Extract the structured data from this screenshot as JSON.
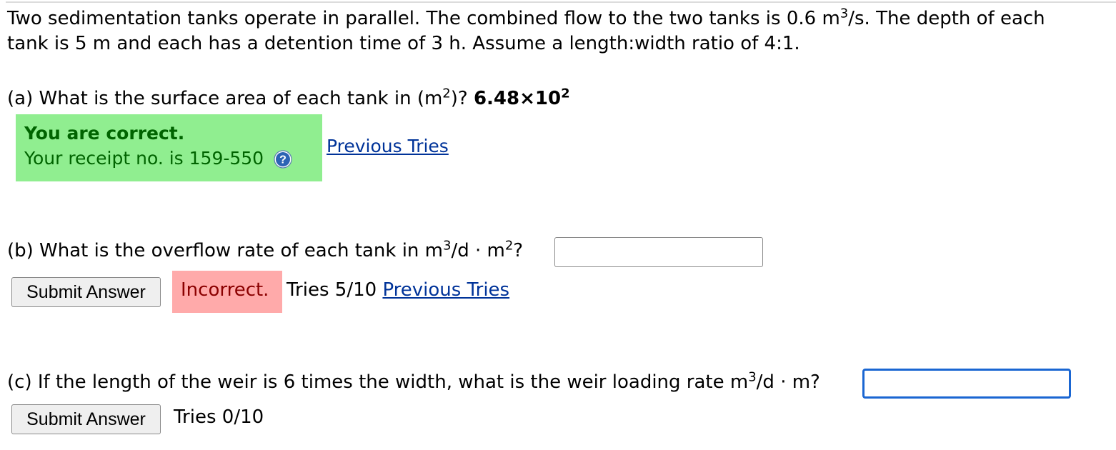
{
  "problem": {
    "line1_pre": "Two sedimentation tanks operate in parallel. The combined flow to the two tanks is 0.6 m",
    "line1_sup": "3",
    "line1_post": "/s. The depth of each",
    "line2": "tank is 5 m and each has a detention time of 3 h. Assume a length:width ratio of 4:1."
  },
  "part_a": {
    "question_pre": "(a) What is the surface area of each tank in (m",
    "question_sup": "2",
    "question_post": ")? ",
    "answer_base": "6.48×10",
    "answer_exp": "2",
    "feedback_title": "You are correct.",
    "receipt_text": "Your receipt no. is 159-550",
    "help_icon": "question-circle-icon",
    "previous_tries": "Previous Tries"
  },
  "part_b": {
    "question_pre": "(b) What is the overflow rate of each tank in m",
    "question_sup1": "3",
    "question_mid": "/d · m",
    "question_sup2": "2",
    "question_post": "?",
    "input_value": "",
    "submit_label": "Submit Answer",
    "status": "Incorrect.",
    "tries": "Tries 5/10",
    "previous_tries": "Previous Tries"
  },
  "part_c": {
    "question_pre": "(c) If the length of the weir is 6 times the width, what is the weir loading rate m",
    "question_sup": "3",
    "question_post": "/d · m?",
    "input_value": "",
    "submit_label": "Submit Answer",
    "tries": "Tries 0/10"
  },
  "colors": {
    "correct_bg": "#90ee90",
    "correct_text": "#006400",
    "incorrect_bg": "#ffaaaa",
    "incorrect_text": "#8b0000",
    "link": "#003399",
    "focus_border": "#1a66d2"
  }
}
